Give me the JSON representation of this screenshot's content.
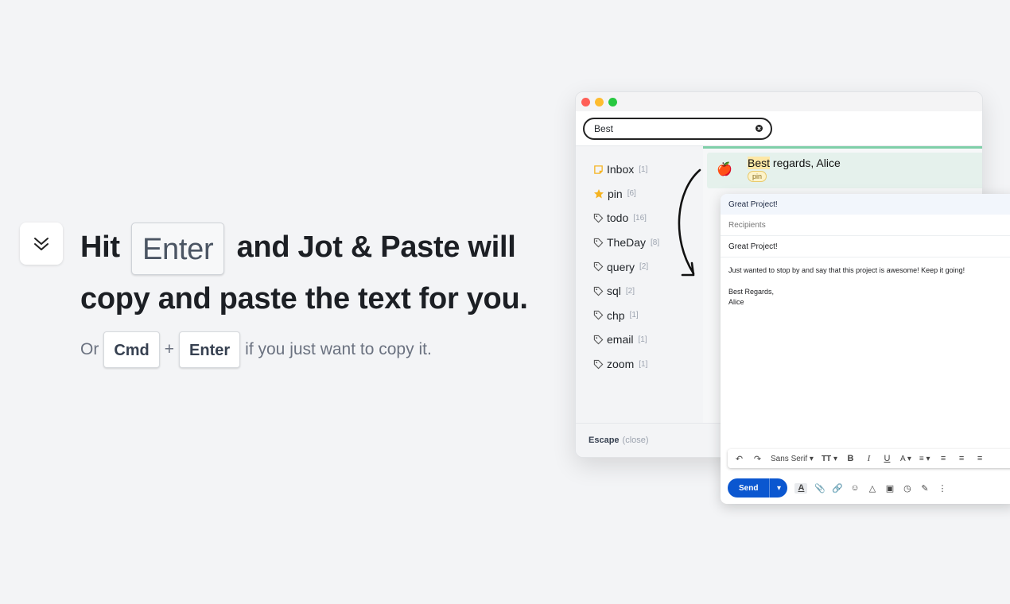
{
  "hero": {
    "headline_pre": "Hit",
    "headline_key": "Enter",
    "headline_post": "and Jot & Paste will copy and paste the text for you.",
    "sub_pre": "Or",
    "sub_key1": "Cmd",
    "sub_plus": "+",
    "sub_key2": "Enter",
    "sub_post": "if you just want to copy it."
  },
  "window": {
    "search_value": "Best",
    "sidebar": [
      {
        "label": "Inbox",
        "count": "[1]",
        "icon": "note-icon"
      },
      {
        "label": "pin",
        "count": "[6]",
        "icon": "star-icon"
      },
      {
        "label": "todo",
        "count": "[16]",
        "icon": "tag-icon"
      },
      {
        "label": "TheDay",
        "count": "[8]",
        "icon": "tag-icon"
      },
      {
        "label": "query",
        "count": "[2]",
        "icon": "tag-icon"
      },
      {
        "label": "sql",
        "count": "[2]",
        "icon": "tag-icon"
      },
      {
        "label": "chp",
        "count": "[1]",
        "icon": "tag-icon"
      },
      {
        "label": "email",
        "count": "[1]",
        "icon": "tag-icon"
      },
      {
        "label": "zoom",
        "count": "[1]",
        "icon": "tag-icon"
      }
    ],
    "result": {
      "highlight": "Best",
      "rest": " regards, Alice",
      "badge": "pin"
    },
    "footer": {
      "key": "Escape",
      "hint": "(close)"
    }
  },
  "compose": {
    "title": "Great Project!",
    "recipients": "Recipients",
    "subject": "Great Project!",
    "body_line1": "Just wanted to stop by and say that this project is awesome! Keep it going!",
    "body_line2": "Best Regards,",
    "body_line3": "Alice",
    "font": "Sans Serif",
    "send": "Send"
  },
  "colors": {
    "accent_green": "#7fcfa8",
    "send_blue": "#0b57d0",
    "highlight": "#fde7a5"
  }
}
